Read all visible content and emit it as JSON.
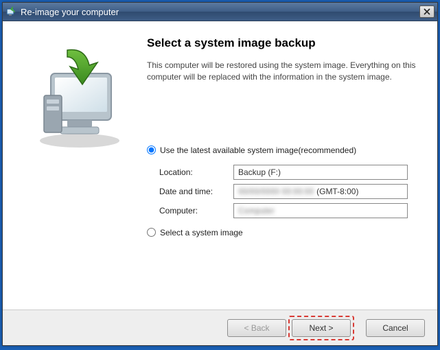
{
  "titlebar": {
    "title": "Re-image your computer"
  },
  "main": {
    "heading": "Select a system image backup",
    "description": "This computer will be restored using the system image. Everything on this computer will be replaced with the information in the system image."
  },
  "options": {
    "use_latest_label": "Use the latest available system image(recommended)",
    "select_image_label": "Select a system image",
    "selected": "use_latest"
  },
  "fields": {
    "location_label": "Location:",
    "location_value": "Backup (F:)",
    "datetime_label": "Date and time:",
    "datetime_value_suffix": "(GMT-8:00)",
    "computer_label": "Computer:"
  },
  "buttons": {
    "back": "< Back",
    "next": "Next >",
    "cancel": "Cancel"
  }
}
